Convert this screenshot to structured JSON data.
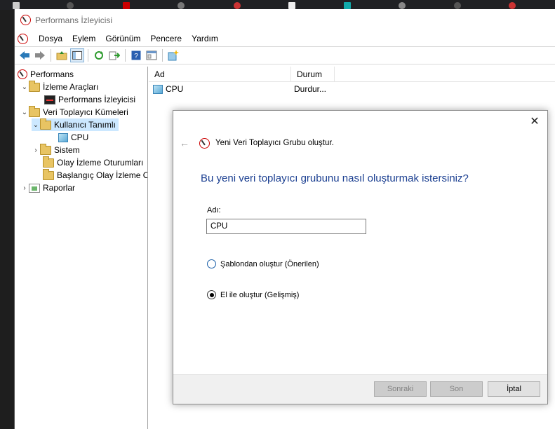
{
  "window": {
    "title": "Performans İzleyicisi"
  },
  "menu": [
    "Dosya",
    "Eylem",
    "Görünüm",
    "Pencere",
    "Yardım"
  ],
  "tree": {
    "root": "Performans",
    "monitoring_tools": "İzleme Araçları",
    "perf_monitor": "Performans İzleyicisi",
    "collector_sets": "Veri Toplayıcı Kümeleri",
    "user_defined": "Kullanıcı Tanımlı",
    "cpu": "CPU",
    "system": "Sistem",
    "event_trace": "Olay İzleme Oturumları",
    "startup_trace": "Başlangıç Olay İzleme O",
    "reports": "Raporlar"
  },
  "list": {
    "col_name": "Ad",
    "col_status": "Durum",
    "rows": [
      {
        "name": "CPU",
        "status": "Durdur..."
      }
    ]
  },
  "dialog": {
    "header": "Yeni Veri Toplayıcı Grubu oluştur.",
    "question": "Bu yeni veri toplayıcı grubunu nasıl oluşturmak istersiniz?",
    "name_label": "Adı:",
    "name_value": "CPU",
    "option_template": "Şablondan oluştur (Önerilen)",
    "option_manual": "El ile oluştur (Gelişmiş)",
    "btn_next": "Sonraki",
    "btn_finish": "Son",
    "btn_cancel": "İptal"
  }
}
